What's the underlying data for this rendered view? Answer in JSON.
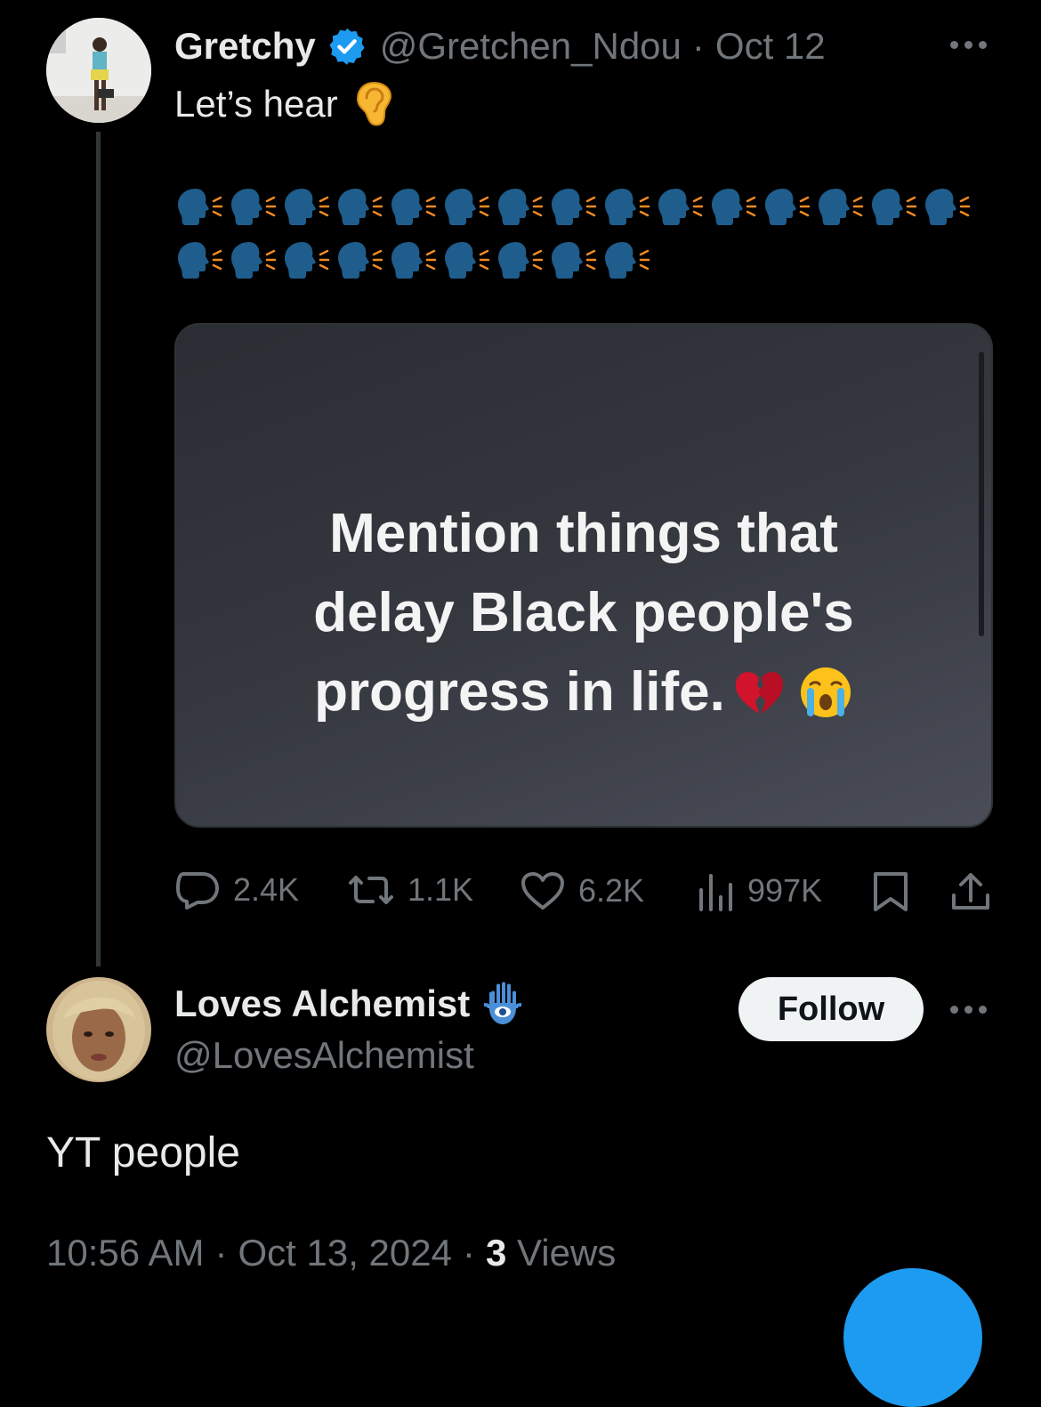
{
  "original_tweet": {
    "display_name": "Gretchy",
    "handle": "@Gretchen_Ndou",
    "separator": "·",
    "date": "Oct 12",
    "text": "Let’s hear",
    "text_emoji": "ear-emoji",
    "emoji_row_1_count": 15,
    "emoji_row_2_count": 9,
    "emoji_name": "speaking-head-emoji",
    "media": {
      "lines": [
        "Mention things that",
        "delay Black people's",
        "progress in life."
      ],
      "trailing_emojis": [
        "broken-heart-emoji",
        "crying-face-emoji"
      ]
    },
    "stats": {
      "replies": "2.4K",
      "reposts": "1.1K",
      "likes": "6.2K",
      "views": "997K"
    }
  },
  "reply": {
    "display_name": "Loves Alchemist",
    "name_emoji": "hamsa-emoji",
    "handle": "@LovesAlchemist",
    "follow_label": "Follow",
    "text": "YT people",
    "time": "10:56 AM",
    "separator_1": "·",
    "date": "Oct 13, 2024",
    "separator_2": "·",
    "views_count": "3",
    "views_label": "Views"
  },
  "colors": {
    "background": "#000000",
    "text_primary": "#e7e9ea",
    "text_muted": "#71767b",
    "accent_blue": "#1d9bf0",
    "verified_blue": "#1d9bf0"
  }
}
